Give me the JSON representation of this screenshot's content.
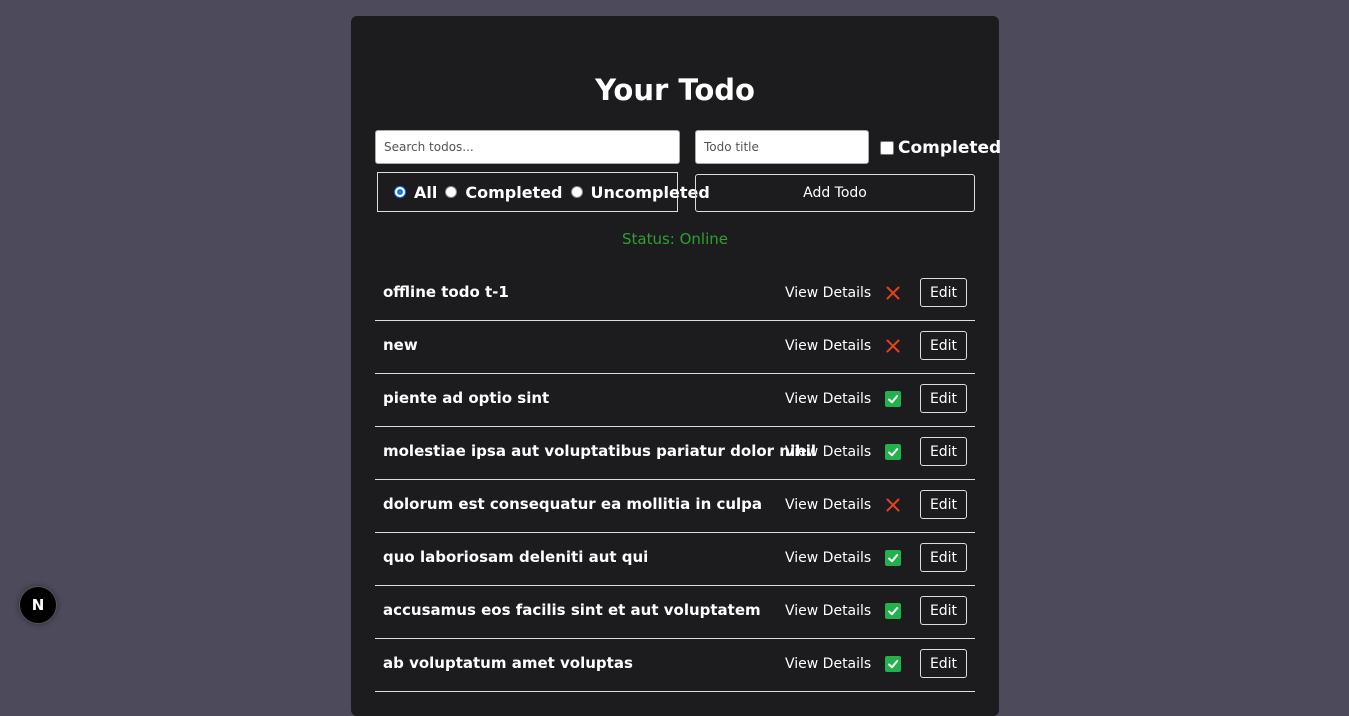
{
  "header": {
    "title": "Your Todo"
  },
  "search": {
    "placeholder": "Search todos..."
  },
  "new_todo": {
    "title_placeholder": "Todo title",
    "completed_label": "Completed",
    "add_label": "Add Todo"
  },
  "filter": {
    "selected": "All",
    "options": [
      {
        "label": "All",
        "checked": true
      },
      {
        "label": "Completed",
        "checked": false
      },
      {
        "label": "Uncompleted",
        "checked": false
      }
    ]
  },
  "status": {
    "text": "Status: Online",
    "color": "#2ea02e"
  },
  "todos": [
    {
      "title": "offline todo t-1",
      "completed": false
    },
    {
      "title": "new",
      "completed": false
    },
    {
      "title": "piente ad optio sint",
      "completed": true
    },
    {
      "title": "molestiae ipsa aut voluptatibus pariatur dolor nihil",
      "completed": true
    },
    {
      "title": "dolorum est consequatur ea mollitia in culpa",
      "completed": false
    },
    {
      "title": "quo laboriosam deleniti aut qui",
      "completed": true
    },
    {
      "title": "accusamus eos facilis sint et aut voluptatem",
      "completed": true
    },
    {
      "title": "ab voluptatum amet voluptas",
      "completed": true
    }
  ],
  "todo_actions": {
    "view_label": "View Details",
    "edit_label": "Edit"
  },
  "icons": {
    "completed": "check-mark-icon",
    "uncompleted": "cross-mark-icon"
  },
  "colors": {
    "background": "#4d4a5c",
    "card": "#1c1c1f",
    "cross": "#e8411f",
    "check": "#22b14c"
  },
  "dev_badge": {
    "label": "N"
  }
}
